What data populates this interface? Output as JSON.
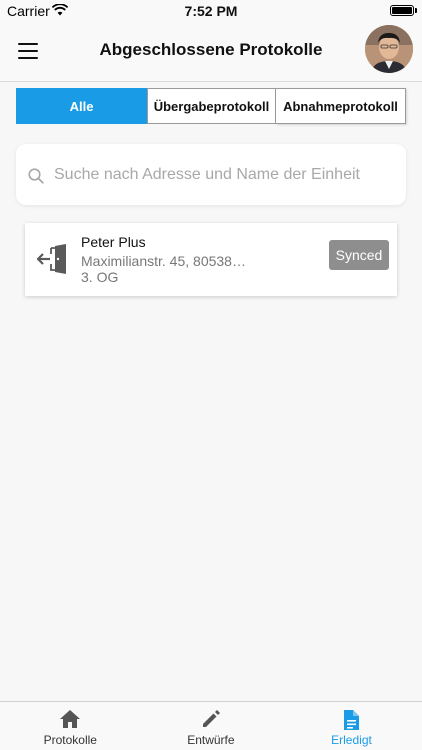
{
  "status_bar": {
    "carrier": "Carrier",
    "time": "7:52 PM"
  },
  "header": {
    "title": "Abgeschlossene Protokolle",
    "menu_icon": "hamburger-menu-icon",
    "avatar": "user-avatar"
  },
  "filters": {
    "segments": [
      "Alle",
      "Übergabeprotokoll",
      "Abnahmeprotokoll"
    ],
    "selected": "Alle",
    "accent_color": "#1a9be6"
  },
  "search": {
    "placeholder": "Suche nach Adresse und Name der Einheit",
    "value": "",
    "icon": "search-icon"
  },
  "protocols": [
    {
      "name": "Peter Plus",
      "address": "Maximilianstr. 45, 80538…",
      "floor": "3. OG",
      "status": "Synced",
      "icon": "door-exit-icon"
    }
  ],
  "tab_bar": {
    "tabs": [
      {
        "label": "Protokolle",
        "icon": "home-icon",
        "active": false
      },
      {
        "label": "Entwürfe",
        "icon": "pencil-icon",
        "active": false
      },
      {
        "label": "Erledigt",
        "icon": "document-icon",
        "active": true
      }
    ]
  }
}
